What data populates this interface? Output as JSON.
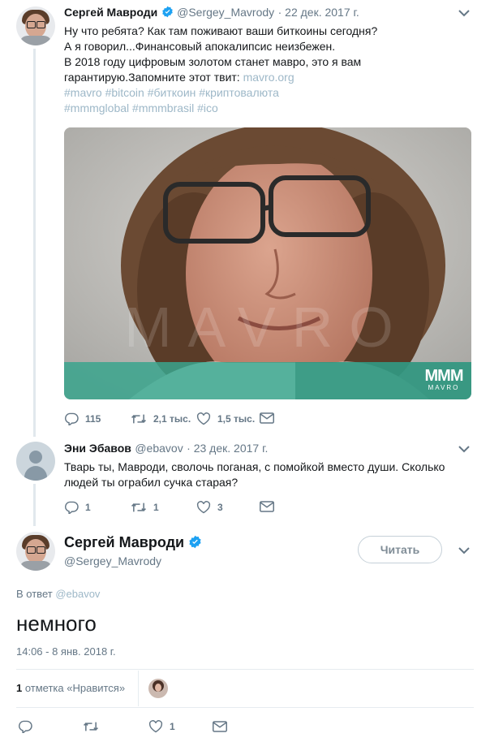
{
  "tweet1": {
    "name": "Сергей Мавроди",
    "handle": "@Sergey_Mavrody",
    "date": "· 22 дек. 2017 г.",
    "line1": "Ну что ребята? Как там поживают ваши биткоины сегодня?",
    "line2": "А я говорил...Финансовый апокалипсис неизбежен.",
    "line3": "В 2018 году цифровым золотом станет мавро, это я вам",
    "line4_text": "гарантирую.Запомните этот твит: ",
    "line4_link": "mavro.org",
    "tags_line1": "#mavro #bitcoin #биткоин #криптовалюта",
    "tags_line2": "#mmmglobal #mmmbrasil #ico",
    "media_watermark": "MAVRO",
    "media_logo": "MMM",
    "replies": "115",
    "retweets": "2,1 тыс.",
    "likes": "1,5 тыс."
  },
  "tweet2": {
    "name": "Эни Эбавов",
    "handle": "@ebavov",
    "date": "· 23 дек. 2017 г.",
    "line1": "Тварь ты, Мавроди, сволочь поганая, с помойкой вместо души. Сколько",
    "line2": "людей ты ограбил сучка старая?",
    "replies": "1",
    "retweets": "1",
    "likes": "3"
  },
  "main_tweet": {
    "name": "Сергей Мавроди",
    "handle": "@Sergey_Mavrody",
    "follow_label": "Читать",
    "reply_prefix": "В ответ ",
    "reply_to": "@ebavov",
    "text": "немного",
    "timestamp": "14:06 - 8 янв. 2018 г.",
    "likes_count": "1",
    "likes_label": " отметка «Нравится»",
    "action_likes": "1"
  },
  "colors": {
    "verified": "#1da1f2",
    "muted": "#657786",
    "link": "#9eb8c8",
    "border": "#e6ecf0"
  },
  "icons": [
    "verified-badge-icon",
    "chevron-down-icon",
    "reply-icon",
    "retweet-icon",
    "like-icon",
    "envelope-icon"
  ]
}
